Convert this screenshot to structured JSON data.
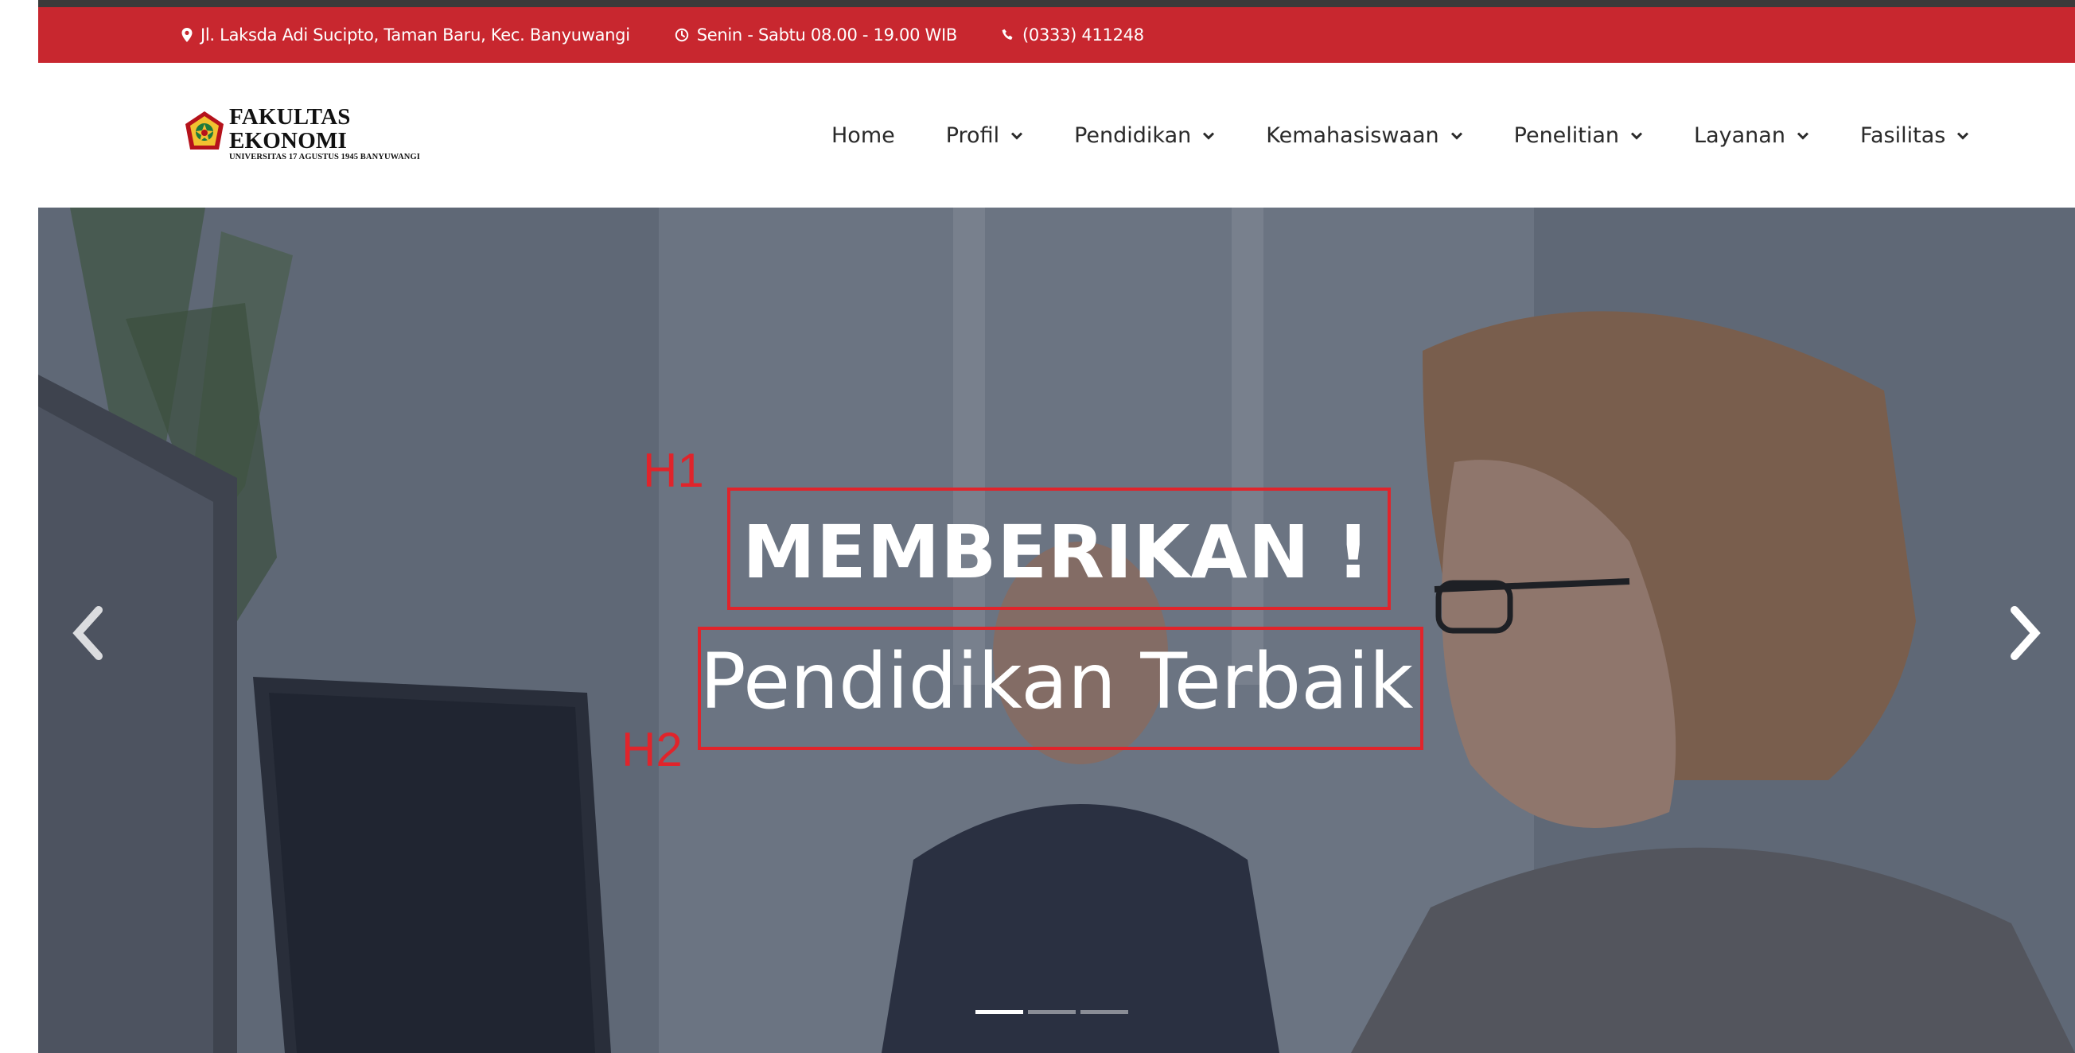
{
  "topbar": {
    "address": "Jl. Laksda Adi Sucipto, Taman Baru, Kec. Banyuwangi",
    "hours": "Senin - Sabtu 08.00 - 19.00 WIB",
    "phone": "(0333) 411248",
    "background": "#c8272f"
  },
  "logo": {
    "title": "FAKULTAS EKONOMI",
    "subtitle": "UNIVERSITAS 17 AGUSTUS 1945 BANYUWANGI"
  },
  "nav": {
    "items": [
      {
        "label": "Home"
      },
      {
        "label": "Profil"
      },
      {
        "label": "Pendidikan"
      },
      {
        "label": "Kemahasiswaan"
      },
      {
        "label": "Penelitian"
      },
      {
        "label": "Layanan"
      },
      {
        "label": "Fasilitas"
      }
    ]
  },
  "hero": {
    "heading": "MEMBERIKAN !",
    "subheading": "Pendidikan Terbaik",
    "slide_count": 3,
    "active_slide": 1
  },
  "annotations": {
    "h1_label": "H1",
    "h2_label": "H2",
    "color": "#e0242b"
  }
}
